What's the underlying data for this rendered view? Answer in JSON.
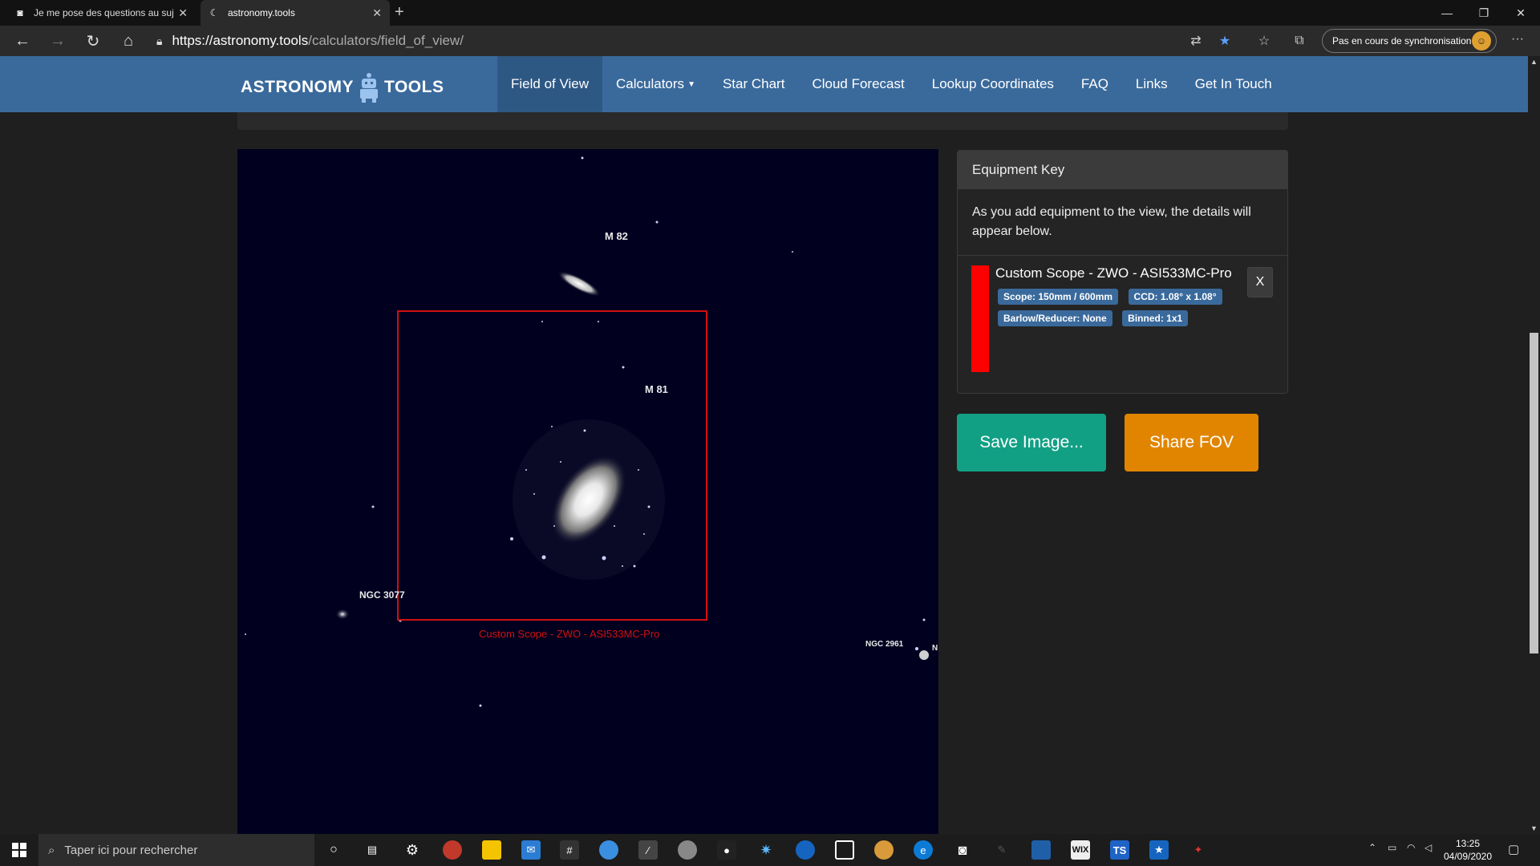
{
  "browser": {
    "tabs": [
      {
        "title": "Je me pose des questions au suj",
        "active": false
      },
      {
        "title": "astronomy.tools",
        "active": true
      }
    ],
    "url_domain": "https://astronomy.tools",
    "url_path": "/calculators/field_of_view/",
    "sync_label": "Pas en cours de synchronisation"
  },
  "site": {
    "logo_left": "ASTRONOMY",
    "logo_right": "TOOLS",
    "nav": [
      {
        "label": "Field of View",
        "active": true
      },
      {
        "label": "Calculators",
        "active": false
      },
      {
        "label": "Star Chart",
        "active": false
      },
      {
        "label": "Cloud Forecast",
        "active": false
      },
      {
        "label": "Lookup Coordinates",
        "active": false
      },
      {
        "label": "FAQ",
        "active": false
      },
      {
        "label": "Links",
        "active": false
      },
      {
        "label": "Get In Touch",
        "active": false
      }
    ]
  },
  "sky": {
    "labels": {
      "m82": "M 82",
      "m81": "M 81",
      "ngc3077": "NGC 3077",
      "ngc2961": "NGC 2961",
      "edge": "N"
    },
    "fov_caption": "Custom Scope - ZWO - ASI533MC-Pro",
    "fov_color": "#d01010"
  },
  "equipment": {
    "title": "Equipment Key",
    "intro": "As you add equipment to the view, the details will appear below.",
    "item": {
      "name": "Custom Scope - ZWO - ASI533MC-Pro",
      "color": "#ff0000",
      "badges": [
        "Scope: 150mm / 600mm",
        "CCD: 1.08° x 1.08°",
        "Barlow/Reducer: None",
        "Binned: 1x1"
      ],
      "remove_label": "X"
    }
  },
  "actions": {
    "save": "Save Image...",
    "share": "Share FOV"
  },
  "taskbar": {
    "search_placeholder": "Taper ici pour rechercher",
    "time": "13:25",
    "date": "04/09/2020"
  }
}
